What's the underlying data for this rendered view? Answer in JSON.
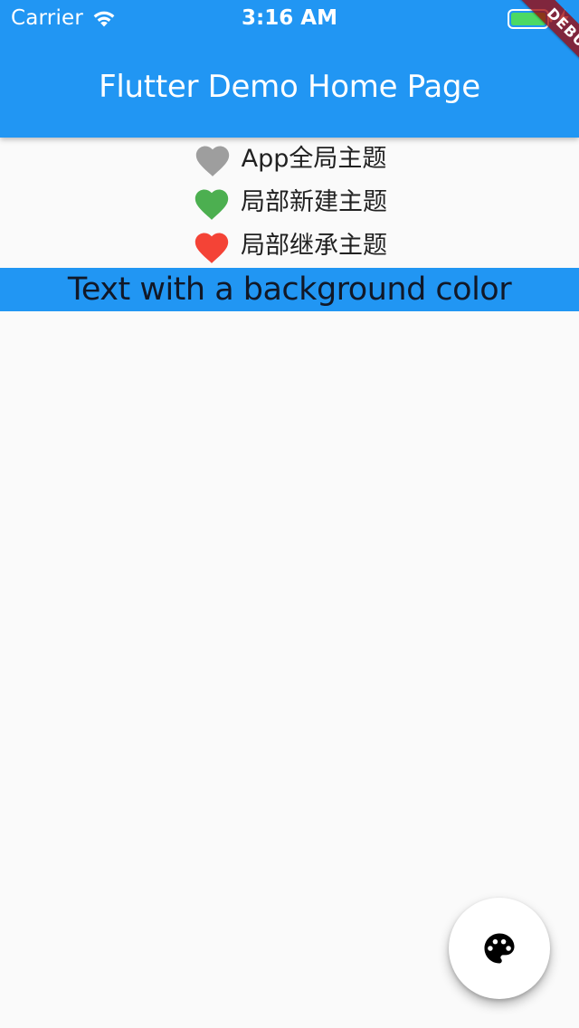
{
  "status_bar": {
    "carrier": "Carrier",
    "time": "3:16 AM",
    "wifi_icon": "wifi-icon",
    "battery_icon": "battery-icon",
    "charging_icon": "charging-icon",
    "battery_color": "#4cd964"
  },
  "app_bar": {
    "title": "Flutter Demo Home Page",
    "color": "#2196f3"
  },
  "debug_banner": {
    "label": "DEBUG"
  },
  "rows": [
    {
      "label": "App全局主题",
      "icon": "heart-icon",
      "color": "#9e9e9e"
    },
    {
      "label": "局部新建主题",
      "icon": "heart-icon",
      "color": "#4caf50"
    },
    {
      "label": "局部继承主题",
      "icon": "heart-icon",
      "color": "#f44336"
    }
  ],
  "background_text": {
    "text": "Text with a background color",
    "background": "#2196f3"
  },
  "fab": {
    "icon": "palette-icon"
  }
}
